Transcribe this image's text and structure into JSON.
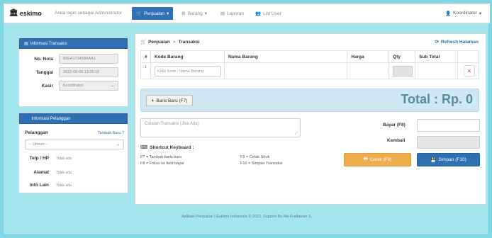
{
  "nav": {
    "brand": "eskimo",
    "subtitle": "Anda login sebagai Administrator",
    "menu": [
      {
        "label": "Penjualan",
        "icon": "cart-icon",
        "active": true
      },
      {
        "label": "Barang",
        "icon": "box-icon",
        "active": false
      },
      {
        "label": "Laporan",
        "icon": "document-icon",
        "active": false
      },
      {
        "label": "List User",
        "icon": "users-icon",
        "active": false
      }
    ],
    "user": "Koordinator"
  },
  "transaction_info": {
    "title": "Informasi Transaksi",
    "nota_label": "No. Nota",
    "nota_value": "82EA17245B6AA1",
    "date_label": "Tanggal",
    "date_value": "2022-08-08 13:35:16",
    "cashier_label": "Kasir",
    "cashier_value": "Koordinator"
  },
  "customer_info": {
    "title": "Informasi Pelanggan",
    "customer_label": "Pelanggan",
    "add_new_link": "Tambah Baru ?",
    "customer_select": "-- Umum --",
    "phone_label": "Telp / HP",
    "phone_value": "Tidak ada",
    "address_label": "Alamat",
    "address_value": "Tidak ada",
    "other_label": "Info Lain",
    "other_value": "Tidak ada"
  },
  "main": {
    "breadcrumb_1": "Penjualan",
    "breadcrumb_sep": ">",
    "breadcrumb_2": "Transaksi",
    "refresh_label": "Refresh Halaman",
    "columns": [
      "#",
      "Kode Barang",
      "Nama Barang",
      "Harga",
      "Qty",
      "Sub Total"
    ],
    "row_number": "1",
    "code_placeholder": "Ketik Kode / Nama Barang",
    "new_row_button": "Baris Baru (F7)",
    "total_label": "Total : Rp. 0",
    "note_placeholder": "Catatan Transaksi (Jika Ada)",
    "bayar_label": "Bayar (F8)",
    "kembali_label": "Kembali",
    "shortcut_title": "Shortcut Keyboard :",
    "shortcuts": [
      "F7 = Tambah baris baru",
      "F8 = Fokus ke field bayar",
      "F9 = Cetak Struk",
      "F10 = Simpan Transaksi"
    ],
    "print_button": "Cetak (F9)",
    "save_button": "Simpan (F10)"
  },
  "footer": "Aplikasi Penjualan | Eskimo Indonesia © 2022. Support By Abi Rudiawan S.",
  "colors": {
    "primary": "#2f6fb3",
    "background": "#a3e5ec",
    "warning": "#f0ad4e",
    "danger": "#d9534f",
    "total_text": "#5c8aa5"
  }
}
